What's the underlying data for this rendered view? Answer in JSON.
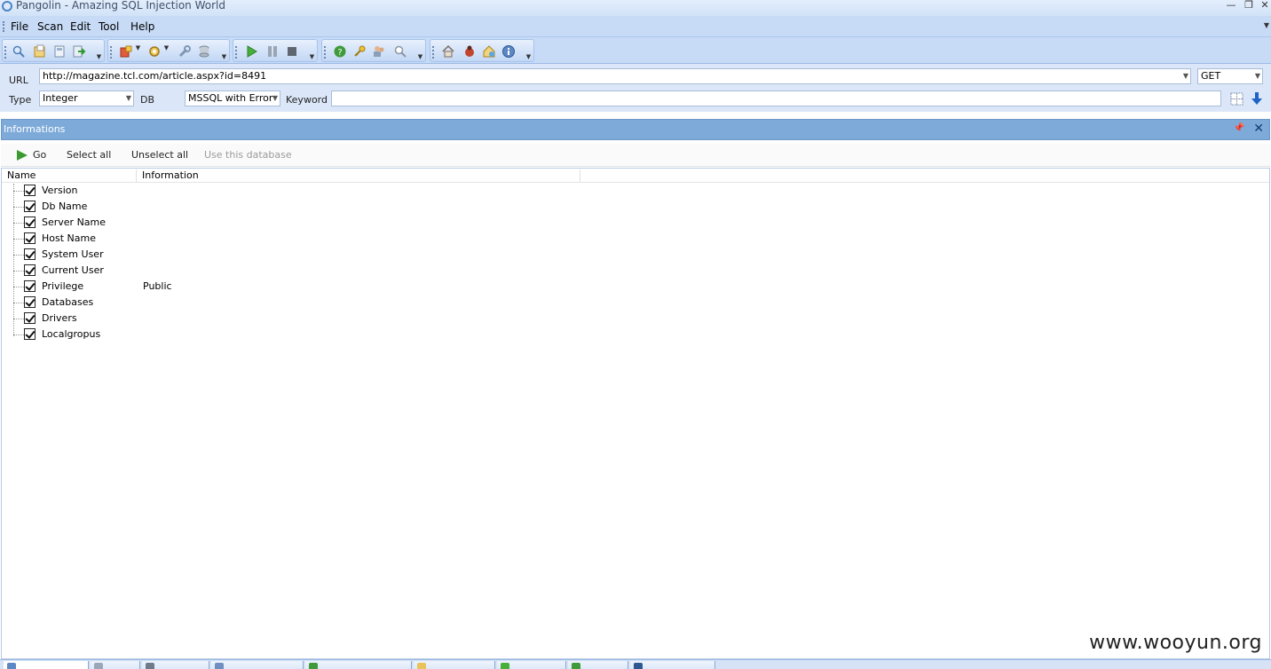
{
  "window": {
    "title": "Pangolin - Amazing SQL Injection World"
  },
  "menu": [
    "File",
    "Scan",
    "Edit",
    "Tool",
    "Help"
  ],
  "toolbar": {
    "groups": [
      [
        "search-icon",
        "open-folder-icon",
        "save-icon",
        "export-icon"
      ],
      [
        "plugin-icon",
        "settings-icon",
        "wrench-icon",
        "database-icon"
      ],
      [
        "start-icon",
        "pause-icon",
        "stop-icon"
      ],
      [
        "help-icon",
        "key-icon",
        "users-icon",
        "search-icon"
      ],
      [
        "home-icon",
        "bug-icon",
        "update-icon",
        "info-icon"
      ]
    ]
  },
  "url_panel": {
    "url_label": "URL",
    "url": "http://magazine.tcl.com/article.aspx?id=8491",
    "method": "GET",
    "type_label": "Type",
    "type_value": "Integer",
    "db_label": "DB",
    "db_value": "MSSQL with Error",
    "keyword_label": "Keyword",
    "keyword_value": ""
  },
  "info_panel": {
    "title": "Informations",
    "toolbar": {
      "go": "Go",
      "select_all": "Select all",
      "unselect_all": "Unselect all",
      "use_db": "Use this database"
    },
    "columns": {
      "name": "Name",
      "information": "Information"
    },
    "rows": [
      {
        "name": "Version",
        "information": "",
        "checked": true
      },
      {
        "name": "Db Name",
        "information": "",
        "checked": true
      },
      {
        "name": "Server Name",
        "information": "",
        "checked": true
      },
      {
        "name": "Host Name",
        "information": "",
        "checked": true
      },
      {
        "name": "System User",
        "information": "",
        "checked": true
      },
      {
        "name": "Current User",
        "information": "",
        "checked": true
      },
      {
        "name": "Privilege",
        "information": "Public",
        "checked": true
      },
      {
        "name": "Databases",
        "information": "",
        "checked": true
      },
      {
        "name": "Drivers",
        "information": "",
        "checked": true
      },
      {
        "name": "Localgropus",
        "information": "",
        "checked": true
      }
    ]
  },
  "watermark": "www.wooyun.org",
  "colors": {
    "chrome": "#c7dbf7",
    "panel_header": "#7eaad9",
    "accent_green": "#3a9a2f"
  }
}
